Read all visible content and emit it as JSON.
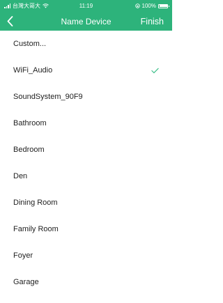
{
  "status_bar": {
    "carrier": "台灣大哥大",
    "time": "11:19",
    "battery_text": "100%",
    "battery_level": 1.0
  },
  "nav": {
    "back_icon": "chevron-left-icon",
    "title": "Name Device",
    "finish_label": "Finish"
  },
  "list": {
    "items": [
      {
        "label": "Custom...",
        "selected": false
      },
      {
        "label": "WiFi_Audio",
        "selected": true
      },
      {
        "label": "SoundSystem_90F9",
        "selected": false
      },
      {
        "label": "Bathroom",
        "selected": false
      },
      {
        "label": "Bedroom",
        "selected": false
      },
      {
        "label": "Den",
        "selected": false
      },
      {
        "label": "Dining Room",
        "selected": false
      },
      {
        "label": "Family Room",
        "selected": false
      },
      {
        "label": "Foyer",
        "selected": false
      },
      {
        "label": "Garage",
        "selected": false
      }
    ]
  },
  "colors": {
    "accent": "#2db37b",
    "checkmark": "#3dbf8a",
    "text": "#222222"
  }
}
